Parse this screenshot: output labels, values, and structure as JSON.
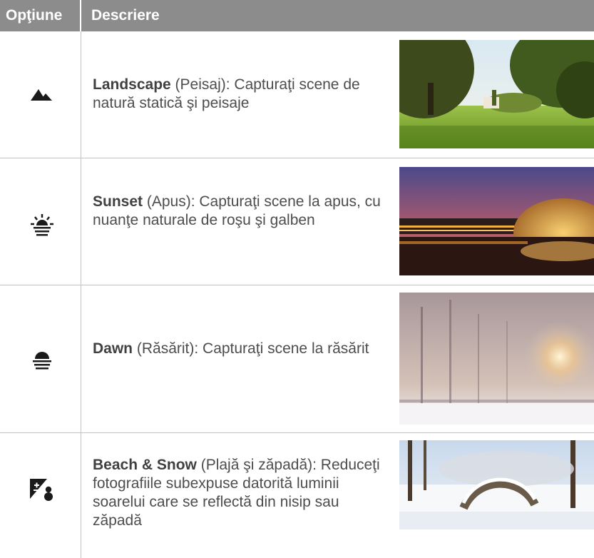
{
  "header": {
    "col_option": "Opţiune",
    "col_description": "Descriere"
  },
  "rows": [
    {
      "icon": "landscape-mountain-icon",
      "title": "Landscape",
      "text": " (Peisaj): Capturaţi scene de natură statică şi peisaje"
    },
    {
      "icon": "sunset-icon",
      "title": "Sunset",
      "text": " (Apus): Capturaţi scene la apus, cu nuanţe naturale de roşu şi galben"
    },
    {
      "icon": "dawn-icon",
      "title": "Dawn",
      "text": " (Răsărit): Capturaţi scene la răsărit"
    },
    {
      "icon": "beach-snow-icon",
      "title": "Beach & Snow",
      "text": " (Plajă şi zăpadă): Reduceţi fotografiile subexpuse datorită luminii soarelui care se reflectă din nisip sau zăpadă"
    }
  ],
  "colors": {
    "header_bg": "#8c8c8c",
    "icon": "#1a1a1a",
    "rule": "#c2c2c2"
  }
}
